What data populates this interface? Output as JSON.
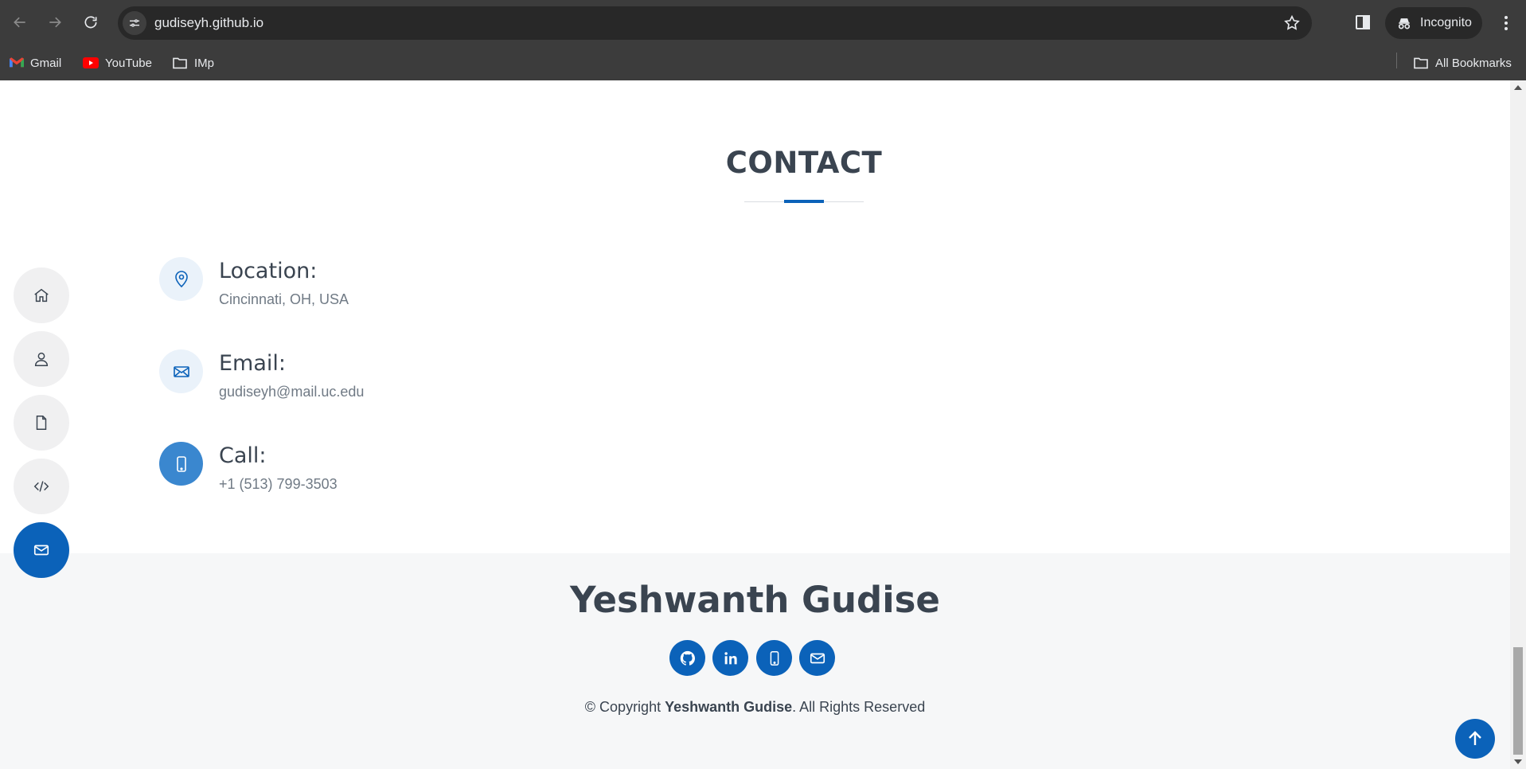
{
  "browser": {
    "url": "gudiseyh.github.io",
    "profile_label": "Incognito",
    "bookmarks": [
      {
        "label": "Gmail",
        "icon": "gmail-icon"
      },
      {
        "label": "YouTube",
        "icon": "youtube-icon"
      },
      {
        "label": "IMp",
        "icon": "folder-icon"
      }
    ],
    "all_bookmarks_label": "All Bookmarks"
  },
  "contact": {
    "title": "CONTACT",
    "items": [
      {
        "label": "Location:",
        "value": "Cincinnati, OH, USA",
        "icon": "map-pin-icon"
      },
      {
        "label": "Email:",
        "value": "gudiseyh@mail.uc.edu",
        "icon": "envelope-icon"
      },
      {
        "label": "Call:",
        "value": "+1 (513) 799-3503",
        "icon": "phone-icon"
      }
    ]
  },
  "side_nav": {
    "items": [
      {
        "icon": "home-icon",
        "active": false
      },
      {
        "icon": "user-icon",
        "active": false
      },
      {
        "icon": "file-icon",
        "active": false
      },
      {
        "icon": "code-icon",
        "active": false
      },
      {
        "icon": "envelope-icon",
        "active": true
      }
    ]
  },
  "footer": {
    "name": "Yeshwanth Gudise",
    "social": [
      "github-icon",
      "linkedin-icon",
      "phone-icon",
      "envelope-icon"
    ],
    "copyright_prefix": "© Copyright ",
    "copyright_name": "Yeshwanth Gudise",
    "copyright_suffix": ". All Rights Reserved"
  },
  "colors": {
    "accent": "#0b62b9",
    "heading": "#3a4450",
    "muted": "#707a85",
    "footer_bg": "#f6f7f8",
    "chrome_bg": "#3c3c3c"
  }
}
